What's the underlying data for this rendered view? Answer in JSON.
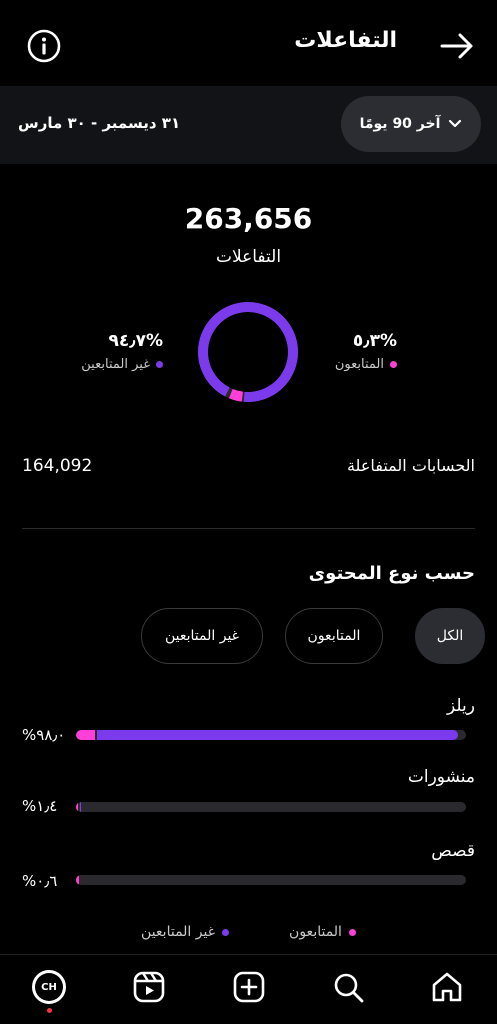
{
  "header": {
    "title": "التفاعلات"
  },
  "date_filter": {
    "range_label": "آخر 90 يومًا",
    "date_range": "٣١ ديسمبر - ٣٠ مارس"
  },
  "summary": {
    "total_value": "263,656",
    "total_label": "التفاعلات",
    "followers": {
      "pct": "%٥٫٣",
      "label": "المتابعون",
      "fraction": 0.053
    },
    "non_followers": {
      "pct": "%٩٤٫٧",
      "label": "غير المتابعين",
      "fraction": 0.947
    }
  },
  "accounts": {
    "label": "الحسابات المتفاعلة",
    "value": "164,092"
  },
  "by_content": {
    "title": "حسب نوع المحتوى",
    "filters": [
      {
        "label": "الكل",
        "active": true
      },
      {
        "label": "المتابعون",
        "active": false
      },
      {
        "label": "غير المتابعين",
        "active": false
      }
    ],
    "types": [
      {
        "label": "ريلز",
        "pct": "%٩٨٫٠",
        "share": 0.98,
        "followers_share": 0.05
      },
      {
        "label": "منشورات",
        "pct": "%١٫٤",
        "share": 0.014,
        "followers_share": 0.2
      },
      {
        "label": "قصص",
        "pct": "%٠٫٦",
        "share": 0.006,
        "followers_share": 1.0
      }
    ],
    "legend": {
      "followers": "المتابعون",
      "non_followers": "غير المتابعين"
    }
  },
  "colors": {
    "followers": "#ff3fd7",
    "non_followers": "#7c3aed"
  },
  "nav": {
    "avatar_text": "CH"
  }
}
